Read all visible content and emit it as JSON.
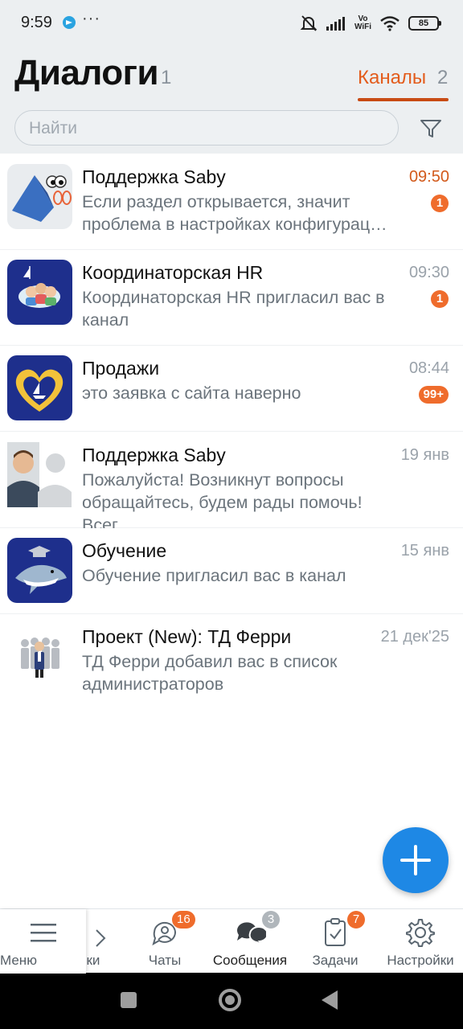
{
  "status_bar": {
    "time": "9:59",
    "dots": "···",
    "vowifi_top": "Vo",
    "vowifi_bottom": "WiFi",
    "battery": "85"
  },
  "header": {
    "title": "Диалоги",
    "title_count": "1",
    "channels_tab": "Каналы",
    "channels_count": "2",
    "search_placeholder": "Найти"
  },
  "dialogs": [
    {
      "name": "Поддержка Saby",
      "time": "09:50",
      "time_accent": true,
      "message": "Если раздел открывается, значит проблема в настройках конфигурац…",
      "badge": "1"
    },
    {
      "name": "Координаторская HR",
      "time": "09:30",
      "message": "Координаторская HR пригласил вас в канал",
      "badge": "1"
    },
    {
      "name": "Продажи",
      "time": "08:44",
      "message": "это заявка с сайта наверно",
      "badge": "99+"
    },
    {
      "name": "Поддержка Saby",
      "time": "19 янв",
      "message": "Пожалуйста! Возникнут вопросы обращайтесь, будем рады помочь! Всег…"
    },
    {
      "name": "Обучение",
      "time": "15 янв",
      "message": "Обучение пригласил вас в канал"
    },
    {
      "name": "Проект (New): ТД Ферри",
      "time": "21 дек'25",
      "message": "ТД Ферри добавил вас в список администраторов"
    }
  ],
  "bottom_nav": {
    "menu": "Меню",
    "contacts_partial": "ики",
    "chats": "Чаты",
    "chats_badge": "16",
    "messages": "Сообщения",
    "messages_badge": "3",
    "tasks": "Задачи",
    "tasks_badge": "7",
    "settings": "Настройки"
  },
  "colors": {
    "accent_orange": "#e35c1c",
    "badge_orange": "#ef6c2c",
    "fab_blue": "#1e88e5",
    "header_bg": "#eceff1"
  }
}
